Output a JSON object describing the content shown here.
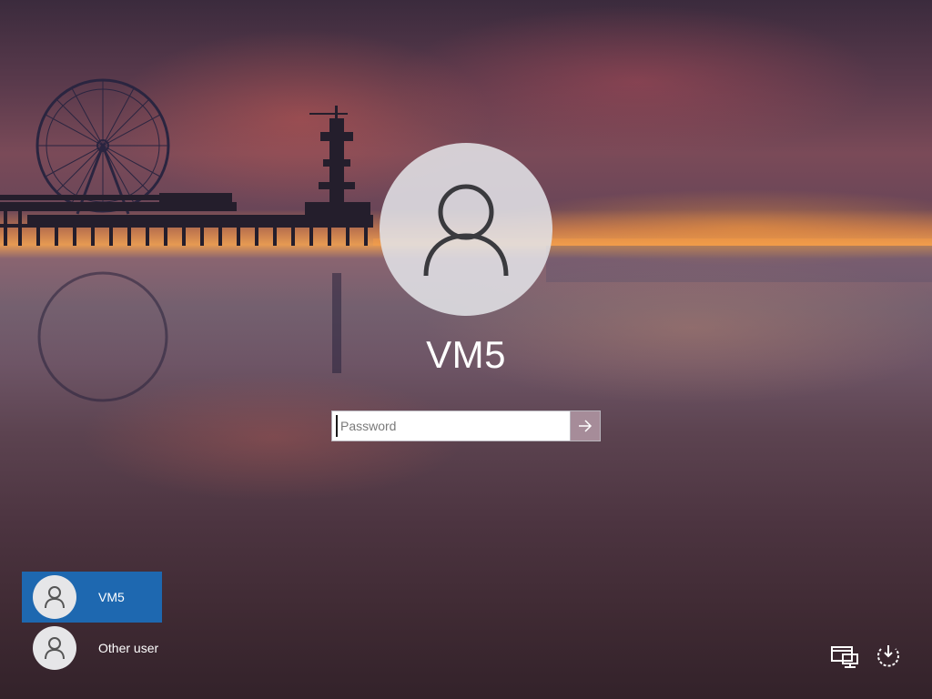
{
  "login": {
    "username": "VM5",
    "password_placeholder": "Password"
  },
  "user_list": [
    {
      "name": "VM5",
      "selected": true
    },
    {
      "name": "Other user",
      "selected": false
    }
  ],
  "icons": {
    "user_tile": "user-icon",
    "submit": "arrow-right-icon",
    "network": "network-icon",
    "power": "power-icon"
  },
  "colors": {
    "selected_user_bg": "#1e68b0",
    "text": "#ffffff"
  }
}
